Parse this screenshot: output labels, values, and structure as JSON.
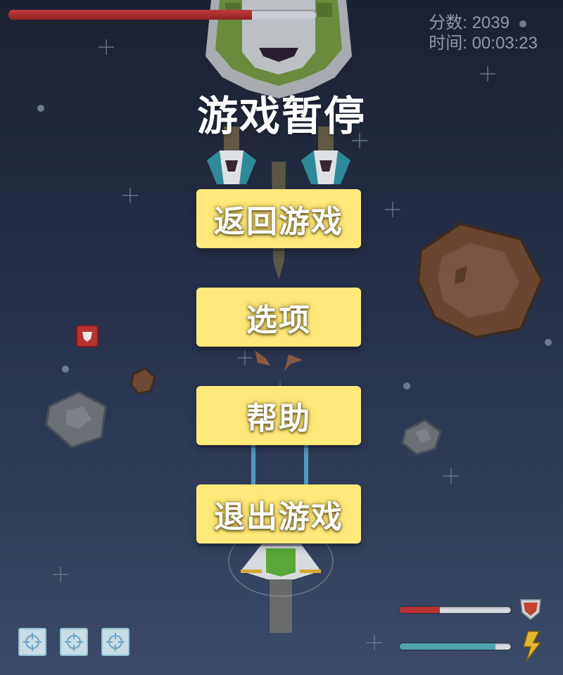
{
  "pause_menu": {
    "title": "游戏暂停",
    "buttons": [
      "返回游戏",
      "选项",
      "帮助",
      "退出游戏"
    ]
  },
  "hud": {
    "score_label": "分数:",
    "score_value": "2039",
    "time_label": "时间:",
    "time_value": "00:03:23"
  },
  "boss": {
    "health_fraction": 0.79
  },
  "player": {
    "health_fraction": 0.36,
    "energy_fraction": 0.86
  },
  "abilities": {
    "slot_count": 3,
    "icon": "crosshair-icon"
  },
  "icons": {
    "shield": "shield-icon",
    "energy": "lightning-icon"
  },
  "colors": {
    "button_fill": "#ffe97a",
    "health_red": "#b83232",
    "energy_teal": "#4fa3ad",
    "boss_health_red": "#b32e2e",
    "player_ship_green": "#5aa83a"
  }
}
